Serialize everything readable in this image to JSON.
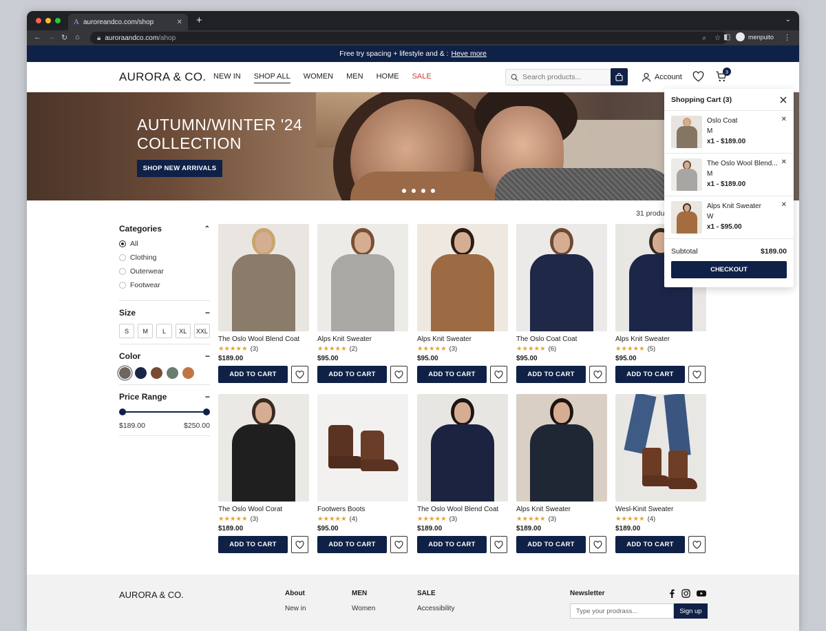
{
  "browser": {
    "tab_title": "auroreandco.com/shop",
    "url_host": "auroraandco.com",
    "url_path": "/ahop",
    "profile_name": "menpuito"
  },
  "promo": {
    "text": "Free try spacing + lifestyle and & :",
    "link": "Heve more"
  },
  "header": {
    "logo": "AURORA & CO.",
    "nav": [
      "NEW IN",
      "SHOP ALL",
      "WOMEN",
      "MEN",
      "HOME",
      "SALE"
    ],
    "search_placeholder": "Search products...",
    "account_label": "Account",
    "cart_count": "3"
  },
  "hero": {
    "title_line1": "AUTUMN/WINTER '24",
    "title_line2": "COLLECTION",
    "cta": "SHOP NEW ARRIVALS"
  },
  "results": {
    "count_text": "31 produc"
  },
  "filters": {
    "categories_title": "Categories",
    "categories": [
      "All",
      "Clothing",
      "Outerwear",
      "Footwear"
    ],
    "size_title": "Size",
    "sizes": [
      "S",
      "M",
      "L",
      "XL",
      "XXL"
    ],
    "color_title": "Color",
    "colors": [
      "#6e665f",
      "#1a2547",
      "#7a4a33",
      "#6a7d6e",
      "#c07546"
    ],
    "price_title": "Price Range",
    "price_min": "$189.00",
    "price_max": "$250.00"
  },
  "products": [
    {
      "name": "The Oslo Wool Blend Coat",
      "stars": "★★★★★",
      "reviews": "(3)",
      "price": "$189.00",
      "add": "ADD TO CART"
    },
    {
      "name": "Alps Knit Sweater",
      "stars": "★★★★★",
      "reviews": "(2)",
      "price": "$95.00",
      "add": "ADD TO CART"
    },
    {
      "name": "Alps Knit Sweater",
      "stars": "★★★★★",
      "reviews": "(3)",
      "price": "$95.00",
      "add": "ADD TO CART"
    },
    {
      "name": "The Oslo Coat Coat",
      "stars": "★★★★★",
      "reviews": "(6)",
      "price": "$95.00",
      "add": "ADD TO CART"
    },
    {
      "name": "Alps Knit Sweater",
      "stars": "★★★★★",
      "reviews": "(5)",
      "price": "$95.00",
      "add": "ADD TO CART"
    },
    {
      "name": "The Oslo Wool Corat",
      "stars": "★★★★★",
      "reviews": "(3)",
      "price": "$189.00",
      "add": "ADD TO CART"
    },
    {
      "name": "Footwers Boots",
      "stars": "★★★★★",
      "reviews": "(4)",
      "price": "$95.00",
      "add": "ADD TO CART"
    },
    {
      "name": "The Oslo Wool Blend Coat",
      "stars": "★★★★★",
      "reviews": "(3)",
      "price": "$189.00",
      "add": "ADD TO CART"
    },
    {
      "name": "Alps Knit Sweater",
      "stars": "★★★★★",
      "reviews": "(3)",
      "price": "$189.00",
      "add": "ADD TO CART"
    },
    {
      "name": "Wesl-Kinit Sweater",
      "stars": "★★★★★",
      "reviews": "(4)",
      "price": "$189.00",
      "add": "ADD TO CART"
    }
  ],
  "cart": {
    "title": "Shopping Cart (3)",
    "items": [
      {
        "name": "Oslo Coat",
        "variant": "M",
        "qty_price": "x1 - $189.00"
      },
      {
        "name": "The Oslo Wool Blend...",
        "variant": "M",
        "qty_price": "x1 - $189.00"
      },
      {
        "name": "Alps Knit Sweater",
        "variant": "W",
        "qty_price": "x1 - $95.00"
      }
    ],
    "subtotal_label": "Subtotal",
    "subtotal_value": "$189.00",
    "checkout": "CHECKOUT"
  },
  "footer": {
    "logo": "AURORA & CO.",
    "cols": [
      {
        "title": "About",
        "link": "New in"
      },
      {
        "title": "MEN",
        "link": "Women"
      },
      {
        "title": "SALE",
        "link": "Accessibility"
      }
    ],
    "newsletter_title": "Newsletter",
    "newsletter_placeholder": "Type your prodrass...",
    "signup": "Sign up"
  }
}
